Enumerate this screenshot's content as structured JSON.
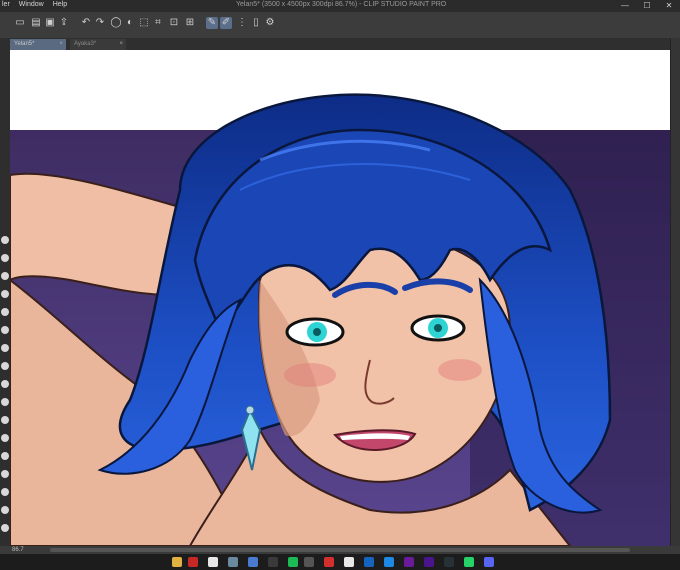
{
  "titlebar": {
    "menu": [
      "ler",
      "Window",
      "Help"
    ],
    "title": "Yelan5* (3500 x 4500px 300dpi 86.7%) - CLIP STUDIO PAINT PRO"
  },
  "window_controls": {
    "minimize": "—",
    "maximize": "☐",
    "close": "✕"
  },
  "toolbar": {
    "icons": [
      "new-file-icon",
      "open-icon",
      "save-icon",
      "export-icon",
      "undo-icon",
      "redo-icon",
      "lasso-icon",
      "fill-icon",
      "transform-icon",
      "select-all-icon",
      "deselect-icon",
      "pen-icon",
      "snap-icon",
      "ruler-icon",
      "settings-icon"
    ]
  },
  "tabs": [
    {
      "label": "Yelan5*",
      "close": "×"
    },
    {
      "label": "Ayaka3*",
      "close": "×"
    }
  ],
  "statusbar": {
    "zoom": "86.7"
  },
  "colors": {
    "background_top": "#3e2c62",
    "background_bottom": "#5a4690",
    "hair": "#1d4fc4",
    "hair_dark": "#0b2a7a",
    "skin": "#f2c2a8",
    "eye": "#2ed4d4",
    "lips": "#c2476b"
  }
}
